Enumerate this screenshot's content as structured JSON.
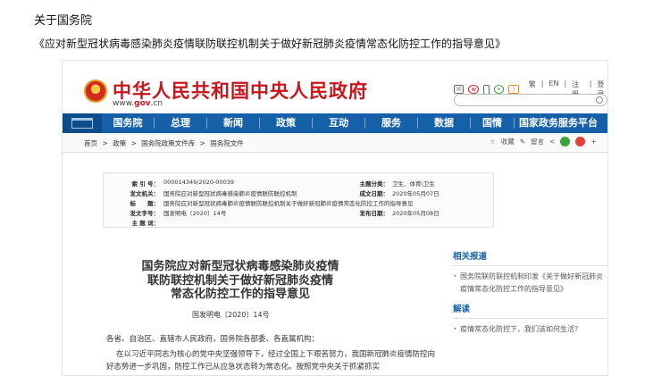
{
  "slide": {
    "title": "关于国务院",
    "subtitle": "《应对新型冠状病毒感染肺炎疫情联防联控机制关于做好新冠肺炎疫情常态化防控工作的指导意见》"
  },
  "header": {
    "site_title": "中华人民共和国中央人民政府",
    "url_prefix": "www.",
    "url_gov": "gov",
    "url_suffix": ".cn",
    "tool_icons": [
      "mail-icon",
      "weibo-icon",
      "mobile-icon",
      "wechat-icon",
      "rss-icon"
    ],
    "tool_links": [
      "繁",
      "EN",
      "注册",
      "登录"
    ]
  },
  "nav": {
    "items": [
      "国务院",
      "总理",
      "新闻",
      "政策",
      "互动",
      "服务",
      "数据",
      "国情",
      "国家政务服务平台"
    ]
  },
  "breadcrumb": {
    "items": [
      "首页",
      ">",
      "政策",
      ">",
      "国务院政策文件库",
      ">",
      "国务院文件"
    ],
    "actions": [
      "收藏",
      "留言"
    ]
  },
  "meta": {
    "index_label": "索 引 号：",
    "index_value": "000014349/2020-00039",
    "topic_label": "主题分类：",
    "topic_value": "卫生、体育\\卫生",
    "issuer_label": "发文机关：",
    "issuer_value": "国务院应对新型冠状病毒感染肺炎疫情联防联控机制",
    "date_label": "成文日期：",
    "date_value": "2020年05月07日",
    "title_label": "标　　题：",
    "title_value": "国务院应对新型冠状病毒肺炎疫情联防联控机制关于做好新冠肺炎疫情常态化防控工作的指导意见",
    "docno_label": "发文字号：",
    "docno_value": "国发明电〔2020〕14号",
    "pub_label": "发布日期：",
    "pub_value": "2020年05月08日",
    "keyword_label": "主 题 词："
  },
  "article": {
    "title_line1": "国务院应对新型冠状病毒感染肺炎疫情",
    "title_line2": "联防联控机制关于做好新冠肺炎疫情",
    "title_line3": "常态化防控工作的指导意见",
    "doc_no": "国发明电〔2020〕14号",
    "salutation": "各省、自治区、直辖市人民政府，国务院各部委、各直属机构：",
    "body": "在以习近平同志为核心的党中央坚强领导下，经过全国上下艰苦努力，我国新冠肺炎疫情防控向好态势进一步巩固，防控工作已从应急状态转为常态化。按照党中央关于抓紧抓实"
  },
  "sidebar": {
    "related_head": "相关报道",
    "related_items": [
      "国务院联防联控机制印发《关于做好新冠肺炎疫情常态化防控工作的指导意见》"
    ],
    "interpret_head": "解读",
    "interpret_items": [
      "疫情常态化防控下，我们该如何生活？"
    ]
  },
  "colors": {
    "brand_red": "#c8161d",
    "nav_blue": "#1560a8"
  }
}
